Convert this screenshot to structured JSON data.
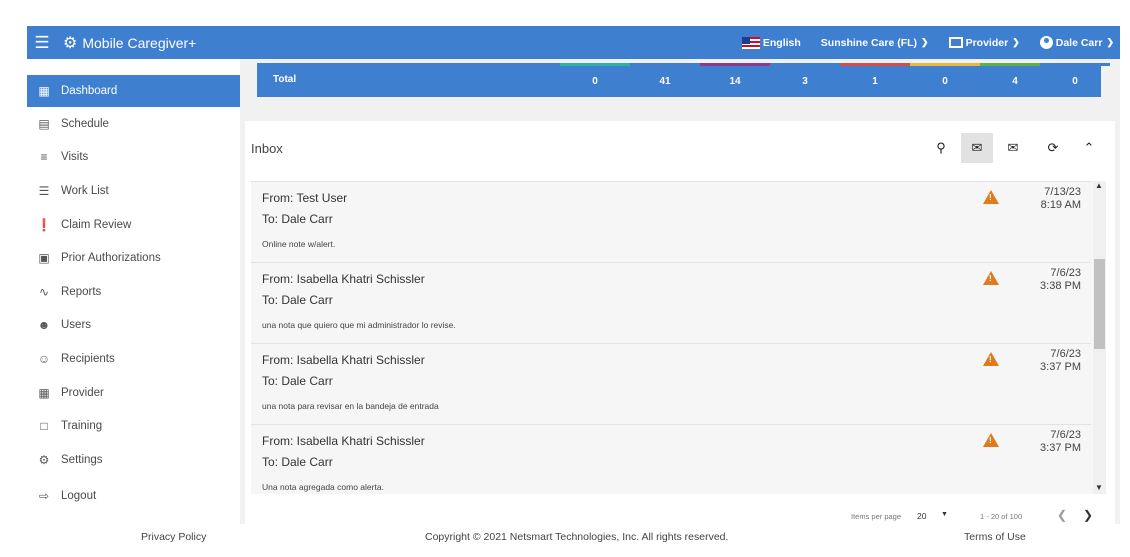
{
  "app": {
    "title": "Mobile Caregiver+"
  },
  "topbar": {
    "language": "English",
    "agency": "Sunshine Care (FL)",
    "role": "Provider",
    "user": "Dale Carr",
    "accent_color": "#3f7fd0"
  },
  "sidebar": {
    "items": [
      {
        "label": "Dashboard",
        "icon": "dashboard-icon",
        "active": true
      },
      {
        "label": "Schedule",
        "icon": "calendar-icon"
      },
      {
        "label": "Visits",
        "icon": "filter-icon"
      },
      {
        "label": "Work List",
        "icon": "list-icon"
      },
      {
        "label": "Claim Review",
        "icon": "alert-circle-icon"
      },
      {
        "label": "Prior Authorizations",
        "icon": "calendar-check-icon"
      },
      {
        "label": "Reports",
        "icon": "trend-icon"
      },
      {
        "label": "Users",
        "icon": "people-icon"
      },
      {
        "label": "Recipients",
        "icon": "people-outline-icon"
      },
      {
        "label": "Provider",
        "icon": "clipboard-icon"
      },
      {
        "label": "Training",
        "icon": "training-icon"
      },
      {
        "label": "Settings",
        "icon": "gear-icon"
      },
      {
        "label": "Logout",
        "icon": "logout-icon"
      }
    ]
  },
  "totals": {
    "label": "Total",
    "values": [
      "0",
      "41",
      "14",
      "3",
      "1",
      "0",
      "4",
      "0"
    ],
    "colors": [
      "#2bb0a8",
      "#3f7fd0",
      "#8e3a8a",
      "#3f7fd0",
      "#d64b4b",
      "#e8b83a",
      "#5fae4a",
      "#3f7fd0"
    ]
  },
  "inbox": {
    "title": "Inbox",
    "messages": [
      {
        "from": "From: Test User",
        "to": "To: Dale Carr",
        "body": "Online note w/alert.",
        "date": "7/13/23",
        "time": "8:19 AM"
      },
      {
        "from": "From: Isabella Khatri Schissler",
        "to": "To: Dale Carr",
        "body": "una nota que quiero que mi administrador lo revise.",
        "date": "7/6/23",
        "time": "3:38 PM"
      },
      {
        "from": "From: Isabella Khatri Schissler",
        "to": "To: Dale Carr",
        "body": "una nota para revisar en la bandeja de entrada",
        "date": "7/6/23",
        "time": "3:37 PM"
      },
      {
        "from": "From: Isabella Khatri Schissler",
        "to": "To: Dale Carr",
        "body": "Una nota agregada como alerta.",
        "date": "7/6/23",
        "time": "3:37 PM"
      }
    ],
    "pager": {
      "items_per_page_label": "Items per page",
      "items_per_page": "20",
      "range": "1 - 20 of 100"
    }
  },
  "footer": {
    "privacy": "Privacy Policy",
    "copyright": "Copyright © 2021 Netsmart Technologies, Inc. All rights reserved.",
    "terms": "Terms of Use"
  }
}
